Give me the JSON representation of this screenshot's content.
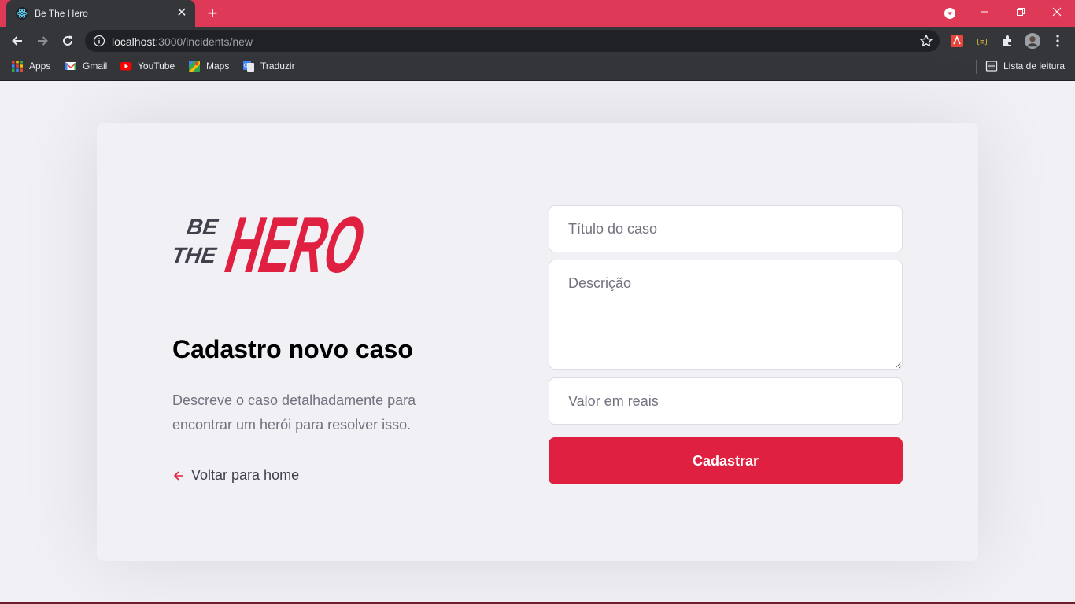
{
  "browser": {
    "tab_title": "Be The Hero",
    "url_host": "localhost",
    "url_path": ":3000/incidents/new",
    "accent_color": "#de3a58",
    "bookmarks": [
      {
        "label": "Apps",
        "icon": "apps-grid-icon"
      },
      {
        "label": "Gmail",
        "icon": "gmail-icon"
      },
      {
        "label": "YouTube",
        "icon": "youtube-icon"
      },
      {
        "label": "Maps",
        "icon": "maps-icon"
      },
      {
        "label": "Traduzir",
        "icon": "translate-icon"
      }
    ],
    "reading_list_label": "Lista de leitura"
  },
  "page": {
    "logo": {
      "line1": "BE",
      "line2": "THE",
      "word": "HERO"
    },
    "title": "Cadastro novo caso",
    "description": "Descreve o caso detalhadamente para encontrar um herói para resolver isso.",
    "back_link": "Voltar para home",
    "form": {
      "title_placeholder": "Título do caso",
      "description_placeholder": "Descrição",
      "value_placeholder": "Valor em reais",
      "submit_label": "Cadastrar"
    },
    "colors": {
      "brand": "#e02041",
      "text_muted": "#737380",
      "background": "#f0f0f5"
    }
  }
}
